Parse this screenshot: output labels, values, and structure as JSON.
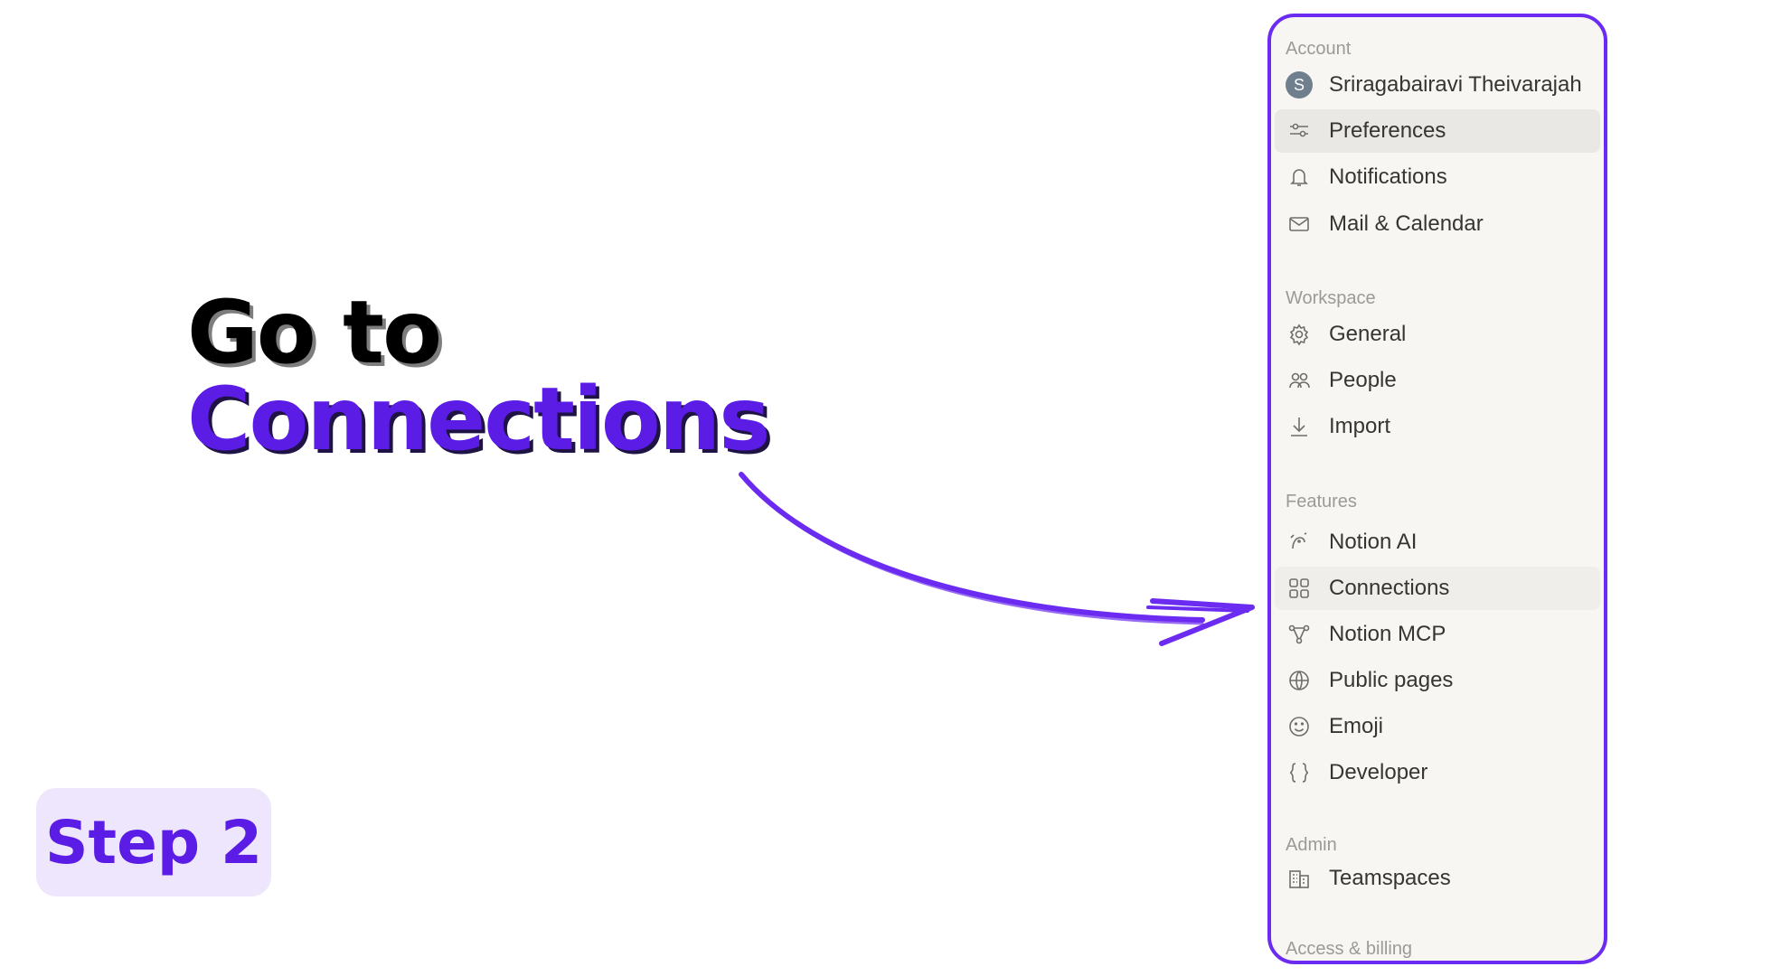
{
  "headline": {
    "line1": "Go to",
    "line2": "Connections",
    "line2_color": "#5b1ce6"
  },
  "step": {
    "label": "Step 2",
    "color": "#5b1ce6"
  },
  "accent_color": "#6b2bf0",
  "settings": {
    "sections": [
      {
        "label": "Account",
        "items": [
          {
            "label": "Sriragabairavi Theivarajah",
            "icon": "avatar-S",
            "avatar_letter": "S"
          },
          {
            "label": "Preferences",
            "icon": "sliders-icon",
            "selected": true
          },
          {
            "label": "Notifications",
            "icon": "bell-icon"
          },
          {
            "label": "Mail & Calendar",
            "icon": "mail-icon"
          }
        ]
      },
      {
        "label": "Workspace",
        "items": [
          {
            "label": "General",
            "icon": "gear-icon"
          },
          {
            "label": "People",
            "icon": "people-icon"
          },
          {
            "label": "Import",
            "icon": "download-icon"
          }
        ]
      },
      {
        "label": "Features",
        "items": [
          {
            "label": "Notion AI",
            "icon": "ai-face-icon"
          },
          {
            "label": "Connections",
            "icon": "grid-icon",
            "highlighted": true
          },
          {
            "label": "Notion MCP",
            "icon": "nodes-icon"
          },
          {
            "label": "Public pages",
            "icon": "globe-icon"
          },
          {
            "label": "Emoji",
            "icon": "smiley-icon"
          },
          {
            "label": "Developer",
            "icon": "braces-icon"
          }
        ]
      },
      {
        "label": "Admin",
        "items": [
          {
            "label": "Teamspaces",
            "icon": "building-icon"
          }
        ]
      },
      {
        "label": "Access & billing",
        "items": []
      }
    ]
  }
}
